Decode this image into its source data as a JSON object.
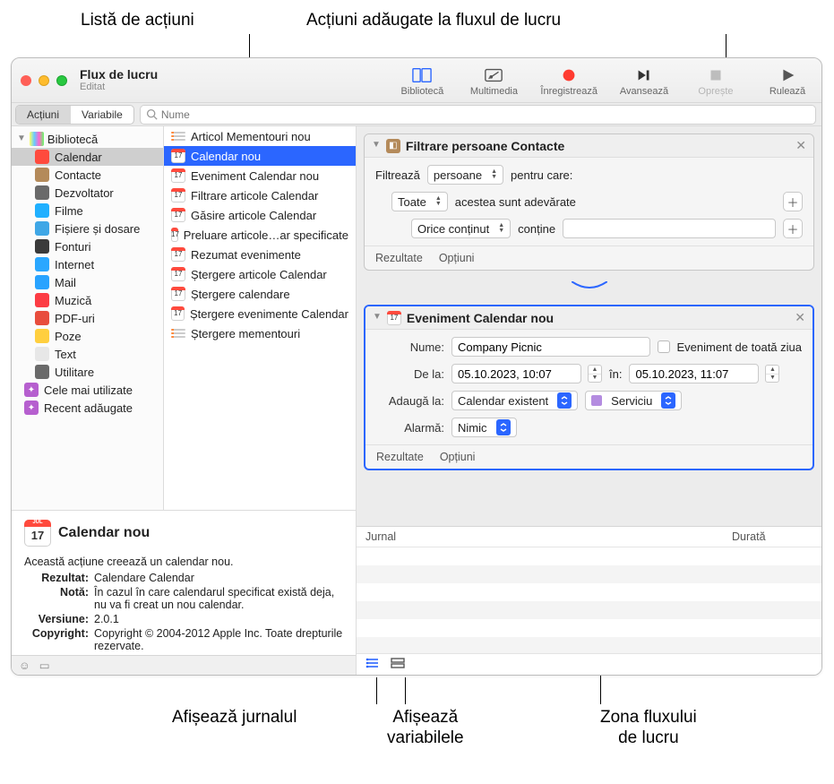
{
  "annotations": {
    "top_left": "Listă de acțiuni",
    "top_right": "Acțiuni adăugate la fluxul de lucru",
    "bottom_left": "Afișează jurnalul",
    "bottom_mid": "Afișează\nvariabilele",
    "bottom_right": "Zona fluxului\nde lucru"
  },
  "window": {
    "title": "Flux de lucru",
    "subtitle": "Editat"
  },
  "toolbar": {
    "library": "Bibliotecă",
    "media": "Multimedia",
    "record": "Înregistrează",
    "step": "Avansează",
    "stop": "Oprește",
    "run": "Rulează"
  },
  "segmented": {
    "actions": "Acțiuni",
    "variables": "Variabile"
  },
  "search": {
    "placeholder": "Nume"
  },
  "library": {
    "root": "Bibliotecă",
    "categories": [
      {
        "label": "Calendar",
        "color": "#ff4a3d"
      },
      {
        "label": "Contacte",
        "color": "#b48a5a"
      },
      {
        "label": "Dezvoltator",
        "color": "#6a6a6a"
      },
      {
        "label": "Filme",
        "color": "#1fb0ff"
      },
      {
        "label": "Fișiere și dosare",
        "color": "#3fa7e6"
      },
      {
        "label": "Fonturi",
        "color": "#3a3a3a"
      },
      {
        "label": "Internet",
        "color": "#2aa7ff"
      },
      {
        "label": "Mail",
        "color": "#28a3ff"
      },
      {
        "label": "Muzică",
        "color": "#fc3c44"
      },
      {
        "label": "PDF-uri",
        "color": "#e84d3d"
      },
      {
        "label": "Poze",
        "color": "#ffcf3f"
      },
      {
        "label": "Text",
        "color": "#e7e7e7"
      },
      {
        "label": "Utilitare",
        "color": "#6a6a6a"
      }
    ],
    "smart": [
      {
        "label": "Cele mai utilizate",
        "color": "#b65fcf"
      },
      {
        "label": "Recent adăugate",
        "color": "#b65fcf"
      }
    ],
    "selected_index": 0
  },
  "actions": {
    "items": [
      {
        "label": "Articol Mementouri nou",
        "icon": "list"
      },
      {
        "label": "Calendar nou",
        "icon": "cal"
      },
      {
        "label": "Eveniment Calendar nou",
        "icon": "cal"
      },
      {
        "label": "Filtrare articole Calendar",
        "icon": "cal"
      },
      {
        "label": "Găsire articole Calendar",
        "icon": "cal"
      },
      {
        "label": "Preluare articole…ar specificate",
        "icon": "cal"
      },
      {
        "label": "Rezumat evenimente",
        "icon": "cal"
      },
      {
        "label": "Ștergere articole Calendar",
        "icon": "cal"
      },
      {
        "label": "Ștergere calendare",
        "icon": "cal"
      },
      {
        "label": "Ștergere evenimente Calendar",
        "icon": "cal"
      },
      {
        "label": "Ștergere mementouri",
        "icon": "list"
      }
    ],
    "selected_index": 1
  },
  "card1": {
    "title": "Filtrare persoane Contacte",
    "filterLabel": "Filtrează",
    "filterSelect": "persoane",
    "filterTrail": "pentru care:",
    "allSelect": "Toate",
    "allTrail": "acestea sunt adevărate",
    "contentSelect": "Orice conținut",
    "contentVerb": "conține",
    "results": "Rezultate",
    "options": "Opțiuni"
  },
  "card2": {
    "title": "Eveniment Calendar nou",
    "nameLabel": "Nume:",
    "nameValue": "Company Picnic",
    "alldayLabel": "Eveniment de toată ziua",
    "fromLabel": "De la:",
    "fromValue": "05.10.2023, 10:07",
    "toLabel": "în:",
    "toValue": "05.10.2023, 11:07",
    "addLabel": "Adaugă la:",
    "addSelect": "Calendar existent",
    "calSelect": "Serviciu",
    "alarmLabel": "Alarmă:",
    "alarmSelect": "Nimic",
    "results": "Rezultate",
    "options": "Opțiuni"
  },
  "info": {
    "title": "Calendar nou",
    "desc": "Această acțiune creează un calendar nou.",
    "result_k": "Rezultat:",
    "result_v": "Calendare Calendar",
    "note_k": "Notă:",
    "note_v": "În cazul în care calendarul specificat există deja, nu va fi creat un nou calendar.",
    "version_k": "Versiune:",
    "version_v": "2.0.1",
    "copyright_k": "Copyright:",
    "copyright_v": "Copyright © 2004-2012 Apple Inc. Toate drepturile rezervate."
  },
  "log": {
    "journal": "Jurnal",
    "duration": "Durată"
  }
}
